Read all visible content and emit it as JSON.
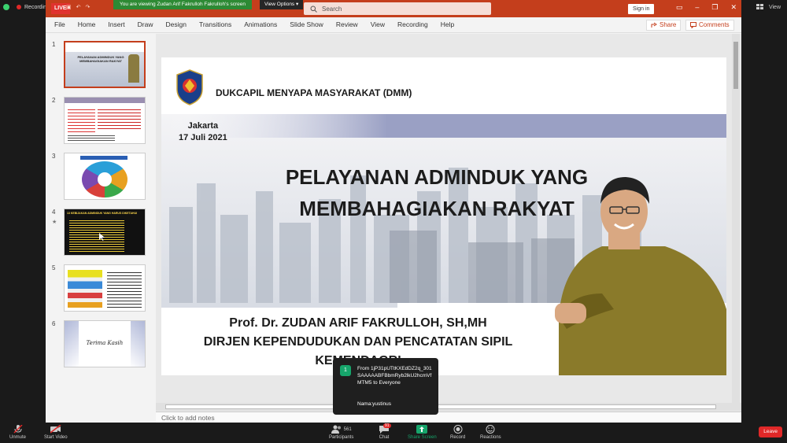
{
  "zoom_top": {
    "recording_label": "Recording",
    "view_label": "View"
  },
  "titlebar": {
    "live_badge": "LIVE",
    "share_banner": "You are viewing Zudan Arif Fakrulloh Fakrulloh's screen",
    "view_options": "View Options",
    "search_placeholder": "Search",
    "sign_in": "Sign in"
  },
  "ribbon": {
    "tabs": [
      "File",
      "Home",
      "Insert",
      "Draw",
      "Design",
      "Transitions",
      "Animations",
      "Slide Show",
      "Review",
      "View",
      "Recording",
      "Help"
    ],
    "share": "Share",
    "comments": "Comments"
  },
  "thumbnails": [
    {
      "num": "1",
      "caption": "PELAYANAN ADMINDUK YANG MEMBAHAGIAKAN RAKYAT"
    },
    {
      "num": "2",
      "caption": ""
    },
    {
      "num": "3",
      "caption": ""
    },
    {
      "num": "4",
      "caption": "13 KEBIJAKAN ADMINDUK YANG HARUS DIKETAHUI"
    },
    {
      "num": "5",
      "caption": ""
    },
    {
      "num": "6",
      "caption": "Terima Kasih"
    }
  ],
  "slide": {
    "header": "DUKCAPIL MENYAPA MASYARAKAT (DMM)",
    "city": "Jakarta",
    "date": "17 Juli 2021",
    "title_line1": "PELAYANAN ADMINDUK YANG",
    "title_line2": "MEMBAHAGIAKAN RAKYAT",
    "author_line1": "Prof. Dr. ZUDAN ARIF FAKRULLOH, SH,MH",
    "author_line2": "DIRJEN KEPENDUDUKAN DAN PENCATATAN SIPIL",
    "author_line3": "KEMENDAGRI"
  },
  "notes_placeholder": "Click to add notes",
  "chat_popup": {
    "badge": "1",
    "from_line": "From 1jP31pUTtKXEdDZ2q_301SAAAAABFBbmRyb2lkU2hcmVfMTM5 to Everyone",
    "message": "Nama:yustinus"
  },
  "zoom_bar": {
    "unmute": "Unmute",
    "start_video": "Start Video",
    "participants": "Participants",
    "participants_count": "561",
    "chat": "Chat",
    "chat_count": "91",
    "share_screen": "Share Screen",
    "record": "Record",
    "reactions": "Reactions",
    "leave": "Leave"
  },
  "colors": {
    "ppt_accent": "#c43e1c",
    "zoom_green": "#16a56b",
    "leave_red": "#e02828"
  }
}
